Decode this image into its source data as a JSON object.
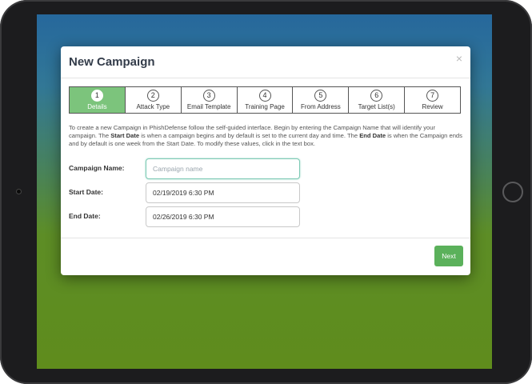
{
  "modal": {
    "title": "New Campaign",
    "close_label": "×"
  },
  "steps": [
    {
      "num": "1",
      "label": "Details",
      "active": true
    },
    {
      "num": "2",
      "label": "Attack Type",
      "active": false
    },
    {
      "num": "3",
      "label": "Email Template",
      "active": false
    },
    {
      "num": "4",
      "label": "Training Page",
      "active": false
    },
    {
      "num": "5",
      "label": "From Address",
      "active": false
    },
    {
      "num": "6",
      "label": "Target List(s)",
      "active": false
    },
    {
      "num": "7",
      "label": "Review",
      "active": false
    }
  ],
  "intro": {
    "part1": "To create a new Campaign in PhishDefense follow the self-guided interface. Begin by entering the Campaign Name that will identify your campaign. The ",
    "bold1": "Start Date",
    "part2": " is when a campaign begins and by default is set to the current day and time. The ",
    "bold2": "End Date",
    "part3": " is when the Campaign ends and by default is one week from the Start Date. To modify these values, click in the text box."
  },
  "form": {
    "campaign_name_label": "Campaign Name:",
    "campaign_name_placeholder": "Campaign name",
    "start_date_label": "Start Date:",
    "start_date_value": "02/19/2019 6:30 PM",
    "end_date_label": "End Date:",
    "end_date_value": "02/26/2019 6:30 PM"
  },
  "footer": {
    "next_label": "Next"
  },
  "colors": {
    "active_step": "#7cc47c",
    "next_button": "#5bb15b",
    "focus_border": "#7cc9b4"
  }
}
